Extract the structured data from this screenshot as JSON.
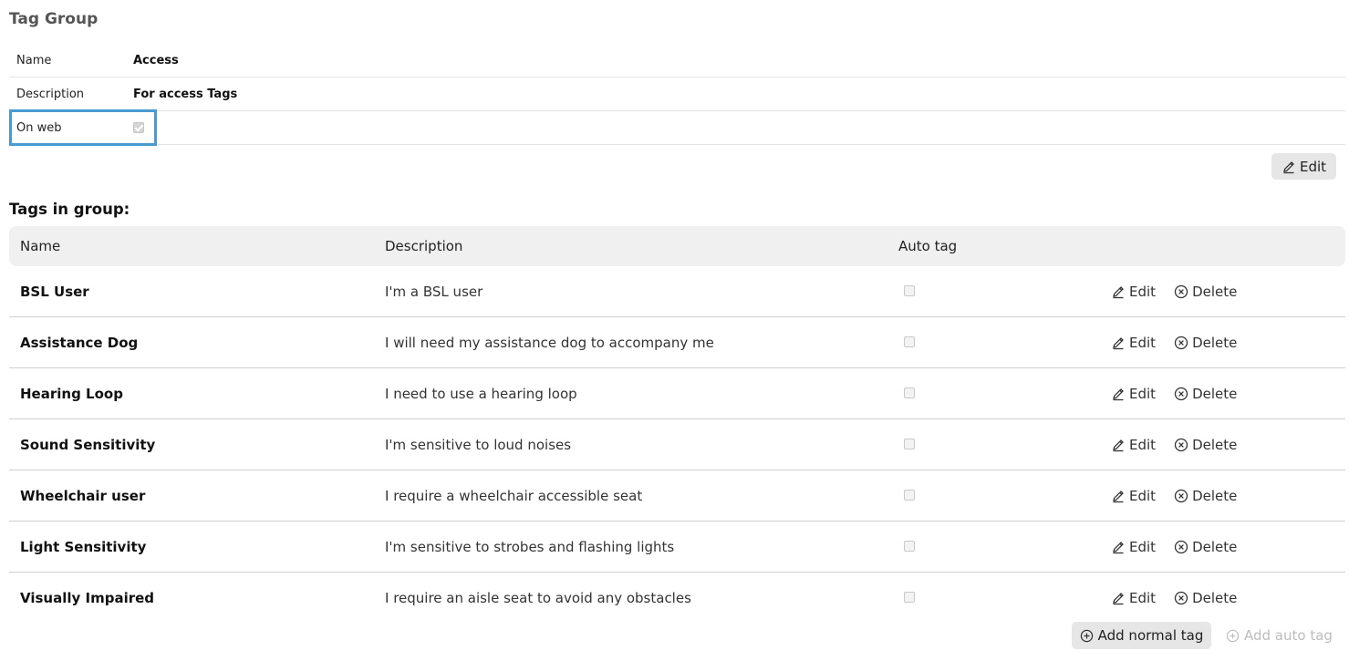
{
  "header": {
    "title": "Tag Group"
  },
  "group": {
    "rows": [
      {
        "label": "Name",
        "value": "Access"
      },
      {
        "label": "Description",
        "value": "For access Tags"
      },
      {
        "label": "On web",
        "checked": true
      }
    ],
    "edit_label": "Edit"
  },
  "tags_section": {
    "title": "Tags in group:",
    "columns": {
      "name": "Name",
      "description": "Description",
      "auto_tag": "Auto tag"
    },
    "rows": [
      {
        "name": "BSL User",
        "description": "I'm a BSL user",
        "auto_tag": false,
        "edit": "Edit",
        "delete": "Delete"
      },
      {
        "name": "Assistance Dog",
        "description": "I will need my assistance dog to accompany me",
        "auto_tag": false,
        "edit": "Edit",
        "delete": "Delete"
      },
      {
        "name": "Hearing Loop",
        "description": "I need to use a hearing loop",
        "auto_tag": false,
        "edit": "Edit",
        "delete": "Delete"
      },
      {
        "name": "Sound Sensitivity",
        "description": "I'm sensitive to loud noises",
        "auto_tag": false,
        "edit": "Edit",
        "delete": "Delete"
      },
      {
        "name": "Wheelchair user",
        "description": "I require a wheelchair accessible seat",
        "auto_tag": false,
        "edit": "Edit",
        "delete": "Delete"
      },
      {
        "name": "Light Sensitivity",
        "description": "I'm sensitive to strobes and flashing lights",
        "auto_tag": false,
        "edit": "Edit",
        "delete": "Delete"
      },
      {
        "name": "Visually Impaired",
        "description": "I require an aisle seat to avoid any obstacles",
        "auto_tag": false,
        "edit": "Edit",
        "delete": "Delete"
      }
    ]
  },
  "actions": {
    "add_normal": "Add normal tag",
    "add_auto": "Add auto tag"
  },
  "colors": {
    "highlight": "#4a9ad4",
    "button_bg": "#e6e6e6",
    "header_bg": "#f0f0f0"
  }
}
